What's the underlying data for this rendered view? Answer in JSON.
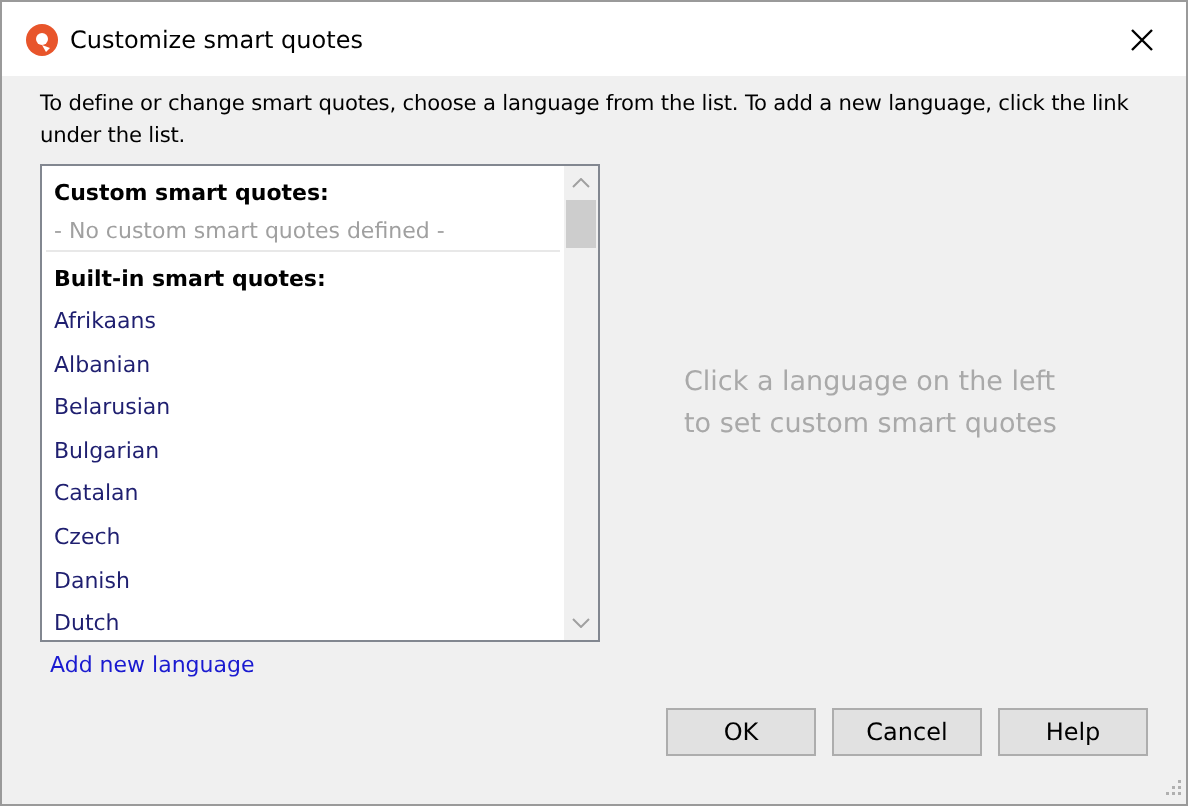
{
  "window": {
    "title": "Customize smart quotes"
  },
  "instructions": "To define or change smart quotes, choose a language from the list. To add a new language, click the link under the list.",
  "custom_section": {
    "heading": "Custom smart quotes:",
    "empty_text": "- No custom smart quotes defined -"
  },
  "builtin_section": {
    "heading": "Built-in smart quotes:",
    "languages": [
      {
        "label": "Afrikaans",
        "selected": false
      },
      {
        "label": "Albanian",
        "selected": false
      },
      {
        "label": "Belarusian",
        "selected": false
      },
      {
        "label": "Bulgarian",
        "selected": false
      },
      {
        "label": "Catalan",
        "selected": false
      },
      {
        "label": "Czech",
        "selected": false
      },
      {
        "label": "Danish",
        "selected": false
      },
      {
        "label": "Dutch",
        "selected": false
      }
    ]
  },
  "add_link": "Add new language",
  "hint": "Click a language on the left to set custom smart quotes",
  "buttons": [
    "OK",
    "Cancel",
    "Help"
  ]
}
